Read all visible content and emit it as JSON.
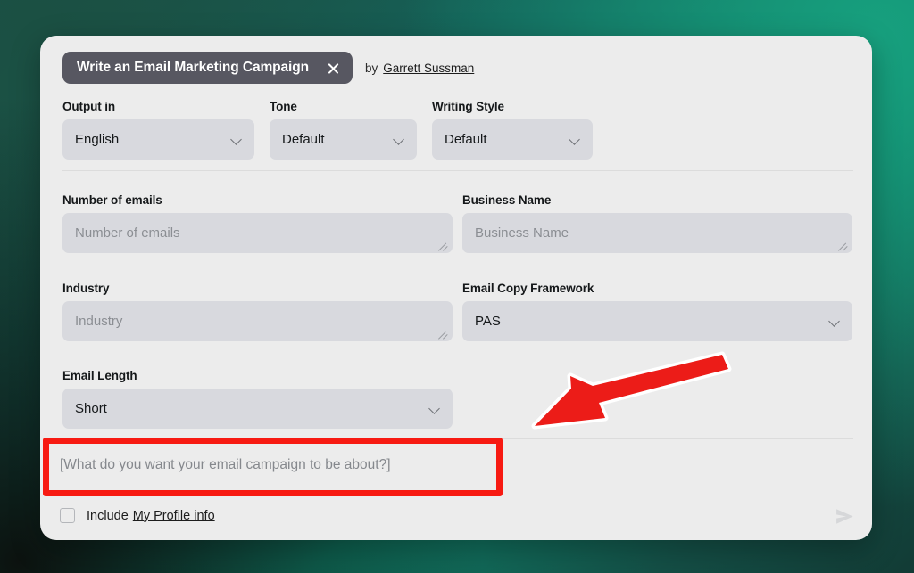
{
  "background": {
    "gradient_from": "#1c5247",
    "gradient_mid": "#0f7f68",
    "gradient_to": "#123b35"
  },
  "header": {
    "title": "Write an Email Marketing Campaign",
    "close_icon": "close-icon",
    "by_label": "by",
    "author": "Garrett Sussman"
  },
  "options": {
    "output_in": {
      "label": "Output in",
      "value": "English"
    },
    "tone": {
      "label": "Tone",
      "value": "Default"
    },
    "writing_style": {
      "label": "Writing Style",
      "value": "Default"
    }
  },
  "fields": {
    "number_of_emails": {
      "label": "Number of emails",
      "value": "",
      "placeholder": "Number of emails"
    },
    "business_name": {
      "label": "Business Name",
      "value": "",
      "placeholder": "Business Name"
    },
    "industry": {
      "label": "Industry",
      "value": "",
      "placeholder": "Industry"
    },
    "email_copy_framework": {
      "label": "Email Copy Framework",
      "value": "PAS"
    },
    "email_length": {
      "label": "Email Length",
      "value": "Short"
    }
  },
  "prompt": {
    "value": "",
    "placeholder": "[What do you want your email campaign to be about?]",
    "send_icon": "send-icon"
  },
  "footer": {
    "include_label": "Include",
    "profile_link": "My Profile info",
    "checkbox_checked": false
  },
  "annotations": {
    "highlight_color": "#f71a12",
    "arrow_color": "#ec1c18",
    "arrow_outline": "#ffffff"
  }
}
